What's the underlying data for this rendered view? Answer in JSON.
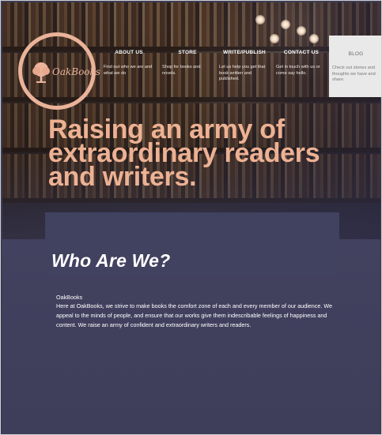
{
  "brand": {
    "logo_text": "OakBooks"
  },
  "nav": {
    "items": [
      {
        "label": "ABOUT US",
        "desc": "Find out who we are and what we do"
      },
      {
        "label": "STORE",
        "desc": "Shop for books and novels."
      },
      {
        "label": "WRITE/PUBLISH",
        "desc": "Let us help you get that book written and published."
      },
      {
        "label": "CONTACT US",
        "desc": "Get in touch with us or come say hello."
      }
    ],
    "blog": {
      "label": "BLOG",
      "desc": "Check out stories and thoughts we have and share."
    }
  },
  "hero": {
    "headline": "Raising an army of extraordinary readers and writers."
  },
  "about": {
    "title": "Who Are We?",
    "brand": "OakBooks",
    "text": "Here at OakBooks, we strive to make books the comfort zone of each and every member of our audience. We appeal to the minds of people, and ensure that our works give them indescribable feelings of happiness and content. We raise an army of confident and extraordinary writers and readers."
  },
  "colors": {
    "accent": "#edb193",
    "panel": "#414160",
    "blog_bg": "#e9e9e9"
  },
  "icons": {
    "logo": "tree-icon"
  }
}
